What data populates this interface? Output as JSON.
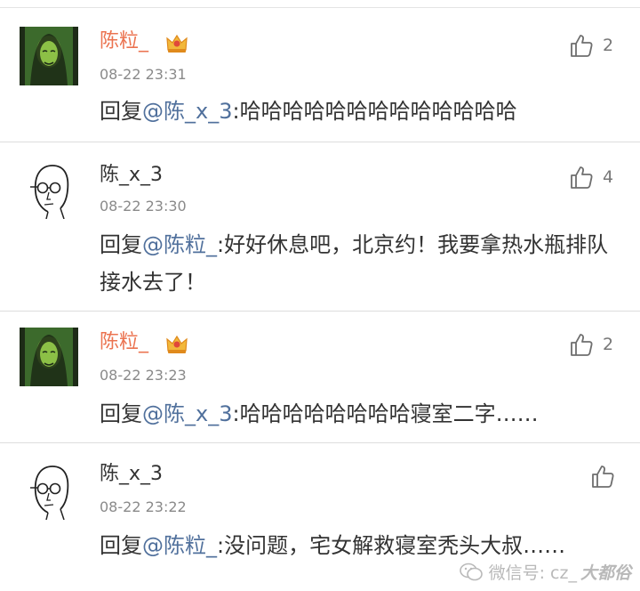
{
  "comments": [
    {
      "user": "陈粒_",
      "vip": true,
      "time": "08-22 23:31",
      "reply_prefix": "回复",
      "mention": "@陈_x_3",
      "text": ":哈哈哈哈哈哈哈哈哈哈哈哈哈",
      "likes": "2",
      "avatar": "green-woman-avatar"
    },
    {
      "user": "陈_x_3",
      "vip": false,
      "time": "08-22 23:30",
      "reply_prefix": "回复",
      "mention": "@陈粒_",
      "text": ":好好休息吧，北京约！我要拿热水瓶排队接水去了！",
      "likes": "4",
      "avatar": "bald-man-sketch-avatar"
    },
    {
      "user": "陈粒_",
      "vip": true,
      "time": "08-22 23:23",
      "reply_prefix": "回复",
      "mention": "@陈_x_3",
      "text": ":哈哈哈哈哈哈哈哈寝室二字……",
      "likes": "2",
      "avatar": "green-woman-avatar"
    },
    {
      "user": "陈_x_3",
      "vip": false,
      "time": "08-22 23:22",
      "reply_prefix": "回复",
      "mention": "@陈粒_",
      "text": ":没问题，宅女解救寝室秃头大叔……",
      "likes": "",
      "avatar": "bald-man-sketch-avatar"
    }
  ],
  "watermark": {
    "label": "微信号: cz_",
    "brand": "大都俗",
    "icon": "wechat-icon"
  },
  "colors": {
    "username_vip": "#eb7350",
    "mention": "#50709c",
    "time": "#8a8a8a",
    "divider": "#dddddd"
  }
}
